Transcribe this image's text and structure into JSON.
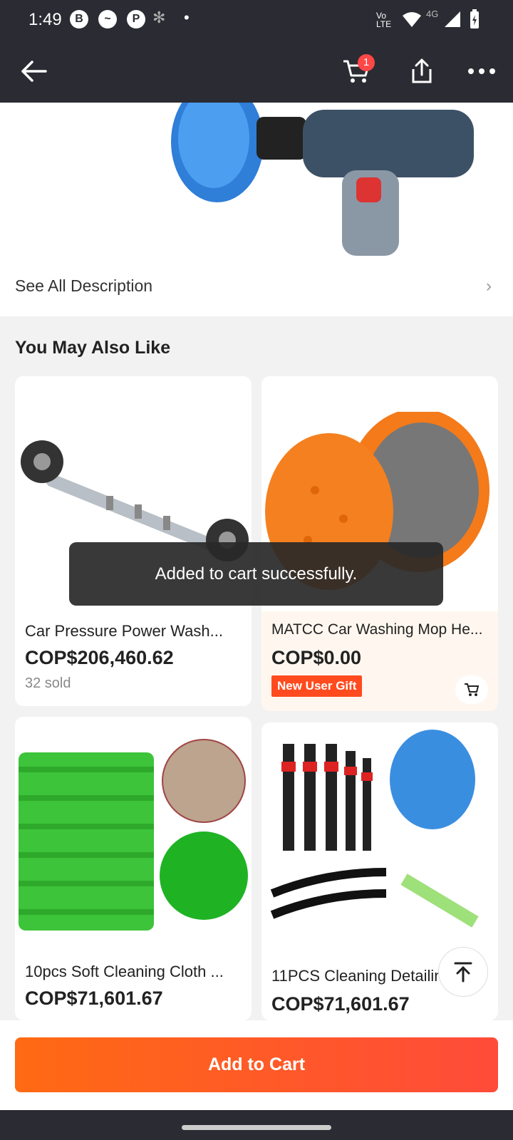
{
  "status_bar": {
    "time": "1:49",
    "signal_label": "4G"
  },
  "top_nav": {
    "cart_count": "1"
  },
  "description": {
    "see_all": "See All Description"
  },
  "recommendations": {
    "title": "You May Also Like",
    "items": [
      {
        "title": "Car Pressure Power Wash...",
        "price": "COP$206,460.62",
        "sold": "32 sold"
      },
      {
        "title": "MATCC Car Washing Mop He...",
        "price": "COP$0.00",
        "tag": "New User Gift"
      },
      {
        "title": "10pcs Soft Cleaning Cloth ...",
        "price": "COP$71,601.67"
      },
      {
        "title": "11PCS Cleaning Detailing ...",
        "price": "COP$71,601.67"
      }
    ]
  },
  "toast": {
    "message": "Added to cart successfully."
  },
  "bottom_bar": {
    "add_to_cart": "Add to Cart"
  },
  "colors": {
    "accent": "#ff5a1f",
    "dark_bar": "#2b2b33",
    "badge": "#ff4747"
  }
}
